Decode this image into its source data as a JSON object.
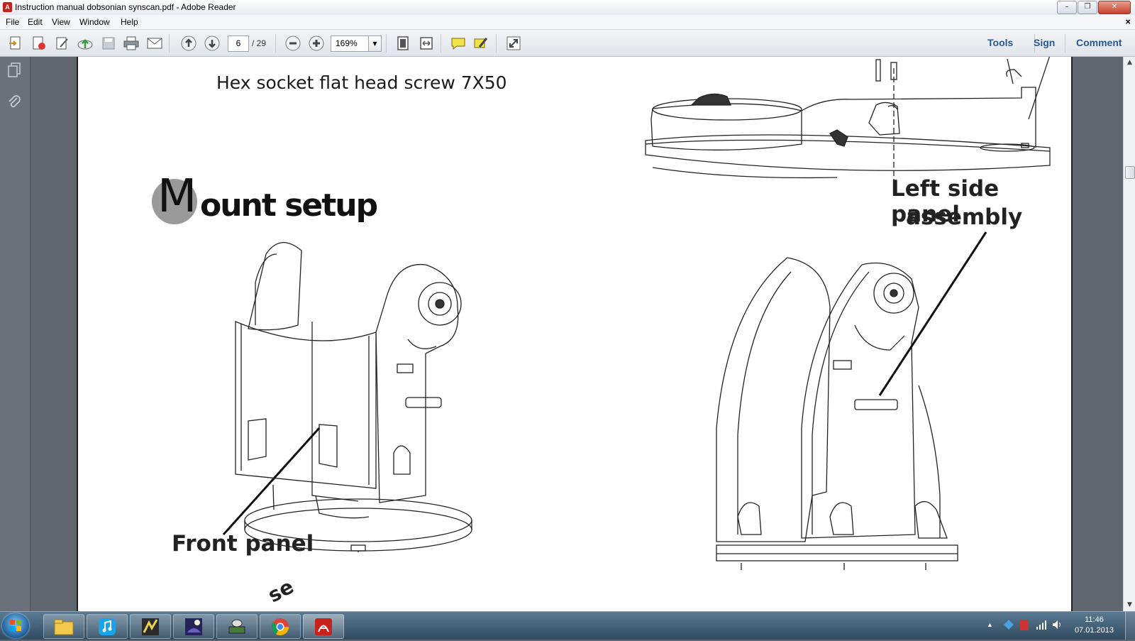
{
  "window": {
    "title": "Instruction manual dobsonian synscan.pdf - Adobe Reader",
    "app_icon": "adobe-reader-icon",
    "controls": [
      "minimize",
      "maximize",
      "close"
    ]
  },
  "menu": {
    "items": [
      "File",
      "Edit",
      "View",
      "Window",
      "Help"
    ],
    "close_glyph": "×"
  },
  "toolbar": {
    "page_current": "6",
    "page_total": "/ 29",
    "zoom": "169%",
    "right_buttons": [
      "Tools",
      "Sign",
      "Comment"
    ],
    "icons": [
      "create-pdf-icon",
      "open-icon",
      "edit-icon",
      "upload-icon",
      "save-icon",
      "print-icon",
      "email-icon",
      "prev-page-icon",
      "next-page-icon",
      "zoom-out-icon",
      "zoom-in-icon",
      "fit-page-icon",
      "fit-width-icon",
      "comment-icon",
      "highlight-icon",
      "fullscreen-icon"
    ]
  },
  "document": {
    "hex_text": "Hex socket flat head screw 7X50",
    "heading_initial": "M",
    "heading_rest": "ount setup",
    "label_left_side": "Left side panel",
    "label_assembly": "assembly",
    "label_front": "Front panel",
    "label_partial": "se"
  },
  "taskbar": {
    "apps": [
      "explorer-icon",
      "itunes-icon",
      "winamp-icon",
      "stellarium-icon",
      "scanner-icon",
      "chrome-icon",
      "adobe-reader-icon"
    ],
    "time": "11:46",
    "date": "07.01.2013"
  }
}
